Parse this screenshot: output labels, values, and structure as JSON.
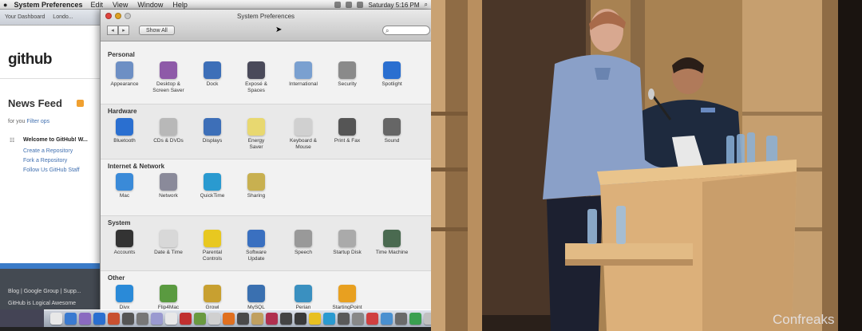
{
  "menubar": {
    "apple": "",
    "app_name": "System Preferences",
    "menus": [
      "Edit",
      "View",
      "Window",
      "Help"
    ],
    "clock": "Saturday 5:16 PM"
  },
  "browser": {
    "tabs": [
      "Your Dashboard",
      "Londo..."
    ],
    "logo": "github",
    "feed_title": "News Feed",
    "for_you": "for you",
    "for_you_link": "Filter ops",
    "welcome": "Welcome to GitHub! W...",
    "welcome_links": [
      "Create a Repository",
      "Fork a Repository",
      "Follow Us GitHub Staff"
    ],
    "footer_links": "Blog | Google Group | Supp...",
    "footer_links2": "GitHub is Logical Awesome"
  },
  "prefs": {
    "window_title": "System Preferences",
    "back": "◂",
    "forward": "▸",
    "show_all": "Show All",
    "search_placeholder": "",
    "sections": [
      {
        "title": "Personal",
        "panes": [
          {
            "label": "Appearance",
            "icon": "appearance-icon",
            "color": "#6d8fc4"
          },
          {
            "label": "Desktop &\nScreen Saver",
            "icon": "desktop-icon",
            "color": "#8e5aa8"
          },
          {
            "label": "Dock",
            "icon": "dock-icon",
            "color": "#3d6fb8"
          },
          {
            "label": "Exposé &\nSpaces",
            "icon": "expose-icon",
            "color": "#4a4a5a"
          },
          {
            "label": "International",
            "icon": "international-icon",
            "color": "#7aa0d0"
          },
          {
            "label": "Security",
            "icon": "security-icon",
            "color": "#8a8a8a"
          },
          {
            "label": "Spotlight",
            "icon": "spotlight-icon",
            "color": "#2a6fd0"
          }
        ]
      },
      {
        "title": "Hardware",
        "panes": [
          {
            "label": "Bluetooth",
            "icon": "bluetooth-icon",
            "color": "#2a6fd0"
          },
          {
            "label": "CDs & DVDs",
            "icon": "cds-dvds-icon",
            "color": "#b8b8b8"
          },
          {
            "label": "Displays",
            "icon": "displays-icon",
            "color": "#3d6fb8"
          },
          {
            "label": "Energy\nSaver",
            "icon": "energy-saver-icon",
            "color": "#e8d870"
          },
          {
            "label": "Keyboard &\nMouse",
            "icon": "keyboard-mouse-icon",
            "color": "#d0d0d0"
          },
          {
            "label": "Print & Fax",
            "icon": "print-fax-icon",
            "color": "#555"
          },
          {
            "label": "Sound",
            "icon": "sound-icon",
            "color": "#666"
          }
        ]
      },
      {
        "title": "Internet & Network",
        "panes": [
          {
            "label": "Mac",
            "icon": "mac-icon",
            "color": "#3a8ad8"
          },
          {
            "label": "Network",
            "icon": "network-icon",
            "color": "#8a8a9a"
          },
          {
            "label": "QuickTime",
            "icon": "quicktime-icon",
            "color": "#2a9ad0"
          },
          {
            "label": "Sharing",
            "icon": "sharing-icon",
            "color": "#c8b050"
          }
        ]
      },
      {
        "title": "System",
        "panes": [
          {
            "label": "Accounts",
            "icon": "accounts-icon",
            "color": "#333"
          },
          {
            "label": "Date & Time",
            "icon": "date-time-icon",
            "color": "#d8d8d8"
          },
          {
            "label": "Parental\nControls",
            "icon": "parental-controls-icon",
            "color": "#e8c820"
          },
          {
            "label": "Software\nUpdate",
            "icon": "software-update-icon",
            "color": "#3a70c0"
          },
          {
            "label": "Speech",
            "icon": "speech-icon",
            "color": "#999"
          },
          {
            "label": "Startup Disk",
            "icon": "startup-disk-icon",
            "color": "#aaa"
          },
          {
            "label": "Time Machine",
            "icon": "time-machine-icon",
            "color": "#4a6a50"
          }
        ]
      },
      {
        "title": "Other",
        "panes": [
          {
            "label": "Divx",
            "icon": "divx-icon",
            "color": "#2a8ad8"
          },
          {
            "label": "Flip4Mac",
            "icon": "flip4mac-icon",
            "color": "#5a9a40"
          },
          {
            "label": "Growl",
            "icon": "growl-icon",
            "color": "#c8a030"
          },
          {
            "label": "MySQL",
            "icon": "mysql-icon",
            "color": "#3a70b0"
          },
          {
            "label": "Perian",
            "icon": "perian-icon",
            "color": "#3a90c0"
          },
          {
            "label": "StartingPoint",
            "icon": "startingpoint-icon",
            "color": "#e8a020"
          }
        ]
      }
    ]
  },
  "dock": {
    "icons": [
      "#e8e8e8",
      "#3a7ad0",
      "#8a6ac0",
      "#2a6fd0",
      "#c85030",
      "#555",
      "#777",
      "#9a9ad0",
      "#e8e8e8",
      "#c03030",
      "#6a9a40",
      "#d0d0d0",
      "#e07020",
      "#4a4a4a",
      "#c0a060",
      "#b03050",
      "#444",
      "#3a3a3a",
      "#e8c020",
      "#2a9ad0",
      "#5a5a5a",
      "#888",
      "#d04040",
      "#4a90d0",
      "#6a6a6a",
      "#3aa050",
      "#c0c0c0",
      "#2a2a2a",
      "#808080",
      "#a05020"
    ]
  },
  "video": {
    "watermark": "Confreaks"
  }
}
